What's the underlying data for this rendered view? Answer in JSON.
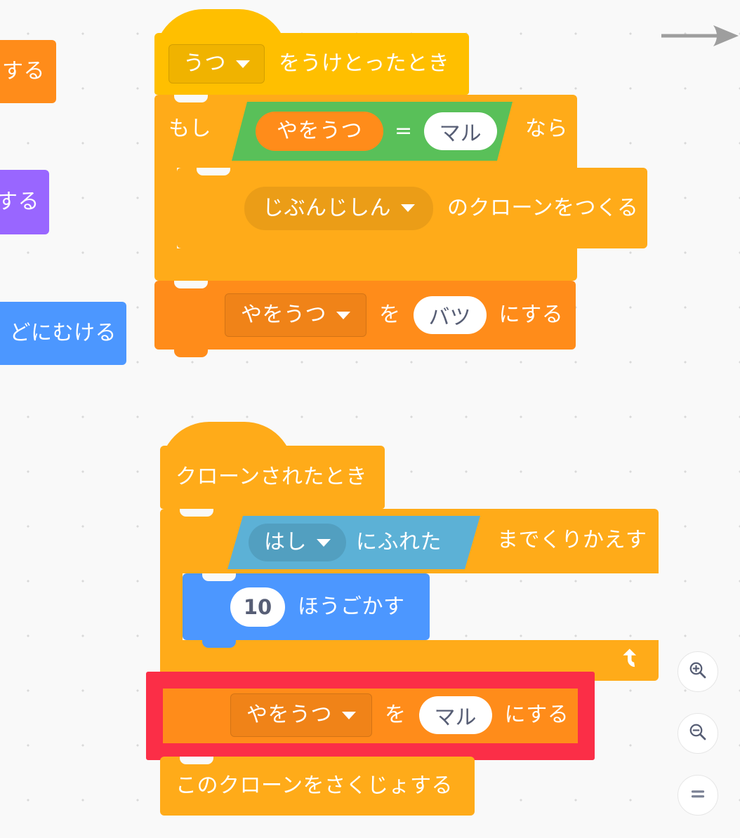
{
  "app": {
    "name": "Scratch Code Workspace",
    "background_color": "#F9F9F9"
  },
  "palette_colors": {
    "events": "#FFBF00",
    "control": "#FFAB19",
    "variables": "#FF8C1A",
    "motion": "#4C97FF",
    "operators": "#59C059",
    "sensing": "#5CB1D6",
    "looks": "#9966FF",
    "highlight_red": "#FB2E47",
    "text_on_block": "#FFFFFF",
    "text_in_oval": "#575E75"
  },
  "partial_blocks_left_edge": [
    {
      "name": "orange-partial-block",
      "label": "する",
      "color": "#FF8C1A"
    },
    {
      "name": "purple-partial-block",
      "label": "する",
      "color": "#9966FF"
    },
    {
      "name": "blue-partial-block",
      "label": "どにむける",
      "color": "#4C97FF"
    }
  ],
  "script_one": {
    "hat": {
      "dropdown_value": "うつ",
      "dropdown_icon": "chevron-down-icon",
      "label_after": "をうけとったとき"
    },
    "if_block": {
      "label_before": "もし",
      "label_after": "なら",
      "condition": {
        "left_operand": "やをうつ",
        "operator": "=",
        "right_operand": "マル"
      },
      "body": [
        {
          "type": "create-clone",
          "dropdown_value": "じぶんじしん",
          "dropdown_icon": "chevron-down-icon",
          "label_after": "のクローンをつくる"
        }
      ]
    },
    "set_variable_block": {
      "dropdown_value": "やをうつ",
      "dropdown_icon": "chevron-down-icon",
      "label_middle": "を",
      "value": "バツ",
      "label_after": "にする"
    }
  },
  "script_two": {
    "hat": {
      "label": "クローンされたとき"
    },
    "repeat_until_block": {
      "condition": {
        "dropdown_value": "はし",
        "dropdown_icon": "chevron-down-icon",
        "label_after": "にふれた"
      },
      "label_after": "までくりかえす",
      "loop_icon": "loop-arrow-icon",
      "body": [
        {
          "type": "move-steps",
          "value": "10",
          "label_after": "ほうごかす"
        }
      ]
    },
    "highlighted_set_variable_block": {
      "dropdown_value": "やをうつ",
      "dropdown_icon": "chevron-down-icon",
      "label_middle": "を",
      "value": "マル",
      "label_after": "にする",
      "highlight": true,
      "highlight_color": "#FB2E47"
    },
    "delete_clone_block": {
      "label": "このクローンをさくじょする"
    }
  },
  "annotations": {
    "arrow": {
      "name": "pointer-arrow-annotation",
      "direction": "right",
      "color": "#9E9E9E"
    }
  },
  "zoom_controls": [
    {
      "name": "zoom-in-button",
      "icon": "magnifier-plus-icon"
    },
    {
      "name": "zoom-out-button",
      "icon": "magnifier-minus-icon"
    },
    {
      "name": "zoom-reset-button",
      "icon": "equals-icon"
    }
  ]
}
